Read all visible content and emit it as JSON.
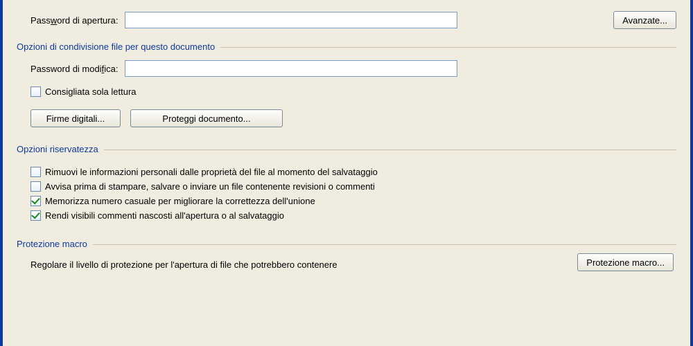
{
  "open_password_label_pre": "Pass",
  "open_password_label_u": "w",
  "open_password_label_post": "ord di apertura:",
  "open_password_value": "",
  "advanced_button": "Avanzate...",
  "share_group_title": "Opzioni di condivisione file per questo documento",
  "modify_password_label_pre": "Password di modi",
  "modify_password_label_u": "f",
  "modify_password_label_post": "ica:",
  "modify_password_value": "",
  "readonly_label_u": "C",
  "readonly_label_post": "onsigliata sola lettura",
  "digital_sig_btn_pre": "Firme ",
  "digital_sig_btn_u": "d",
  "digital_sig_btn_post": "igitali...",
  "protect_doc_btn_u": "P",
  "protect_doc_btn_post": "roteggi documento...",
  "privacy_group_title": "Opzioni riservatezza",
  "chk_remove_u": "R",
  "chk_remove_post": "imuovi le informazioni personali dalle proprietà del file al momento del salvataggio",
  "chk_warn_u": "A",
  "chk_warn_post": "vvisa prima di stampare, salvare o inviare un file contenente revisioni o commenti",
  "chk_random_pre": "Memorizza numero casuale per migliorare la corre",
  "chk_random_u": "t",
  "chk_random_post": "tezza dell'unione",
  "chk_hidden_pre": "Rendi visibili commenti ",
  "chk_hidden_u": "n",
  "chk_hidden_post": "ascosti all'apertura o al salvataggio",
  "macro_group_title": "Protezione macro",
  "macro_desc": "Regolare il livello di protezione per l'apertura di file che potrebbero contenere",
  "macro_button": "Protezione macro..."
}
